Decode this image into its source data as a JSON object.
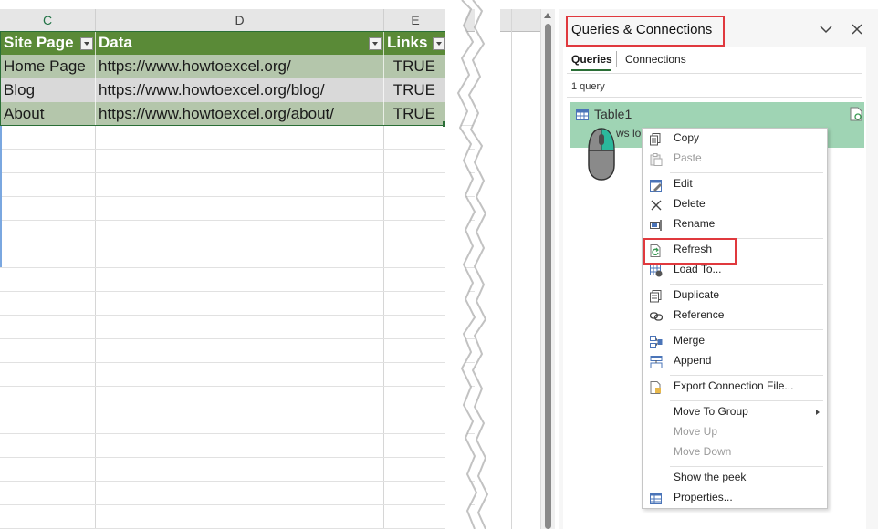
{
  "spreadsheet": {
    "columns": [
      "C",
      "D",
      "E"
    ],
    "table_headers": [
      "Site Page",
      "Data",
      "Links"
    ],
    "rows": [
      [
        "Home Page",
        "https://www.howtoexcel.org/",
        "TRUE"
      ],
      [
        "Blog",
        "https://www.howtoexcel.org/blog/",
        "TRUE"
      ],
      [
        "About",
        "https://www.howtoexcel.org/about/",
        "TRUE"
      ]
    ],
    "header_color": "#5a8a37",
    "row_color": "#b4c6ab"
  },
  "pane": {
    "title": "Queries & Connections",
    "tabs": [
      "Queries",
      "Connections"
    ],
    "active_tab": "Queries",
    "query_count": "1 query",
    "query_name": "Table1",
    "query_status_partial": "ws lo",
    "highlight_color": "#e0393e"
  },
  "context_menu": {
    "copy": "Copy",
    "paste": "Paste",
    "edit": "Edit",
    "delete": "Delete",
    "rename": "Rename",
    "refresh": "Refresh",
    "load_to": "Load To...",
    "duplicate": "Duplicate",
    "reference": "Reference",
    "merge": "Merge",
    "append": "Append",
    "export": "Export Connection File...",
    "move_to_group": "Move To Group",
    "move_up": "Move Up",
    "move_down": "Move Down",
    "show_peek": "Show the peek",
    "properties": "Properties..."
  }
}
